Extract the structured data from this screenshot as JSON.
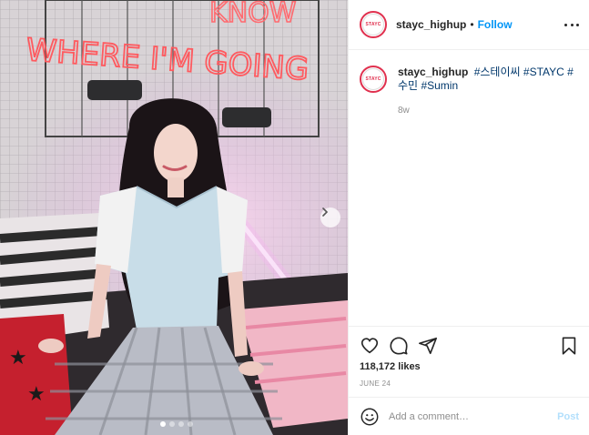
{
  "post": {
    "username": "stayc_highup",
    "follow_label": "Follow",
    "header_separator": "•",
    "avatar_logo_text": "STAYC",
    "caption": {
      "username": "stayc_highup",
      "hashtags": [
        "#스테이씨",
        "#STAYC",
        "#수민",
        "#Sumin"
      ]
    },
    "time_ago": "8w",
    "likes": "118,172 likes",
    "date": "JUNE 24"
  },
  "comment": {
    "placeholder": "Add a comment…",
    "post_label": "Post"
  },
  "photo": {
    "neon_text_line1": "WHERE I'M GOING",
    "neon_text_top": "KNOW",
    "carousel_total": 4,
    "carousel_active": 1
  },
  "colors": {
    "accent_link": "#0095f6",
    "post_disabled": "#b2dffc",
    "hashtag": "#00376b",
    "neon": "#ff5a5f"
  },
  "icons": [
    "more-options-icon",
    "heart-icon",
    "comment-icon",
    "share-icon",
    "bookmark-icon",
    "emoji-icon",
    "chevron-right-icon"
  ]
}
